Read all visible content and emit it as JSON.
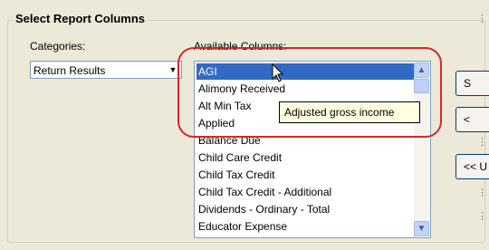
{
  "group": {
    "title": "Select Report Columns"
  },
  "categories": {
    "label": "Categories:",
    "selected": "Return Results"
  },
  "available": {
    "label": "Available Columns:",
    "items": [
      "AGI",
      "Alimony Received",
      "Alt Min Tax",
      "Applied",
      "Balance Due",
      "Child Care Credit",
      "Child Tax Credit",
      "Child Tax Credit - Additional",
      "Dividends - Ordinary - Total",
      "Educator Expense"
    ],
    "selected_index": 0
  },
  "tooltip": {
    "text": "Adjusted gross income"
  },
  "side_buttons": {
    "first": "S",
    "second": "<",
    "third": "<< U"
  },
  "colors": {
    "selection": "#316ac5",
    "highlight_ring": "#d6262c",
    "tooltip_bg": "#ffffe1",
    "dialog_bg": "#ece9d8"
  }
}
